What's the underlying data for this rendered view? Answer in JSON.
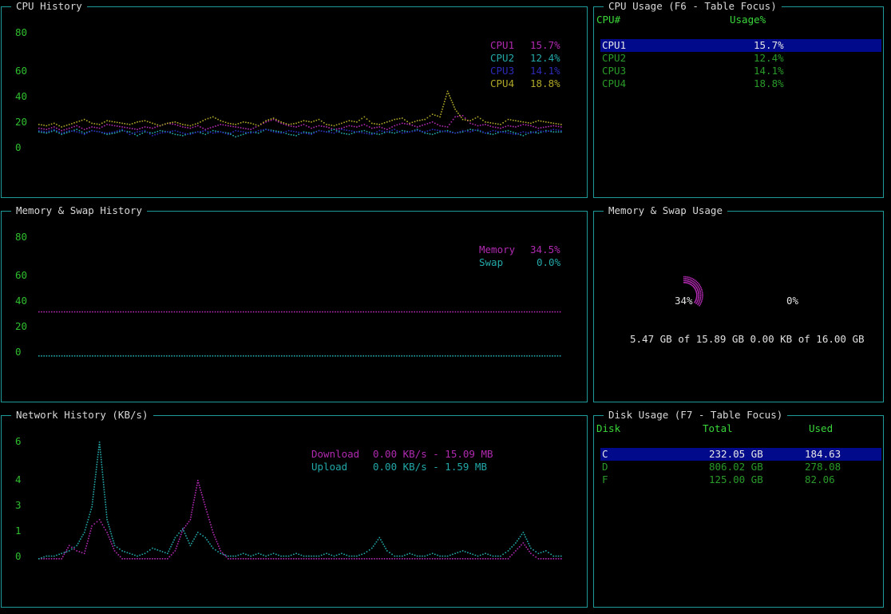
{
  "colors": {
    "border": "#1f9a9a",
    "cpu1": "#b02ab0",
    "cpu2": "#23a8a8",
    "cpu3": "#2b2bb8",
    "cpu4": "#b0a828",
    "memory": "#b02ab0",
    "swap": "#23a8a8",
    "download": "#b02ab0",
    "upload": "#23a8a8",
    "selection": "#000a8a",
    "axis": "#2fbf2f"
  },
  "cpu_history": {
    "title": "CPU History",
    "y_ticks": [
      "80",
      "60",
      "40",
      "20",
      "0"
    ],
    "legend": [
      {
        "name": "CPU1",
        "value": "15.7%"
      },
      {
        "name": "CPU2",
        "value": "12.4%"
      },
      {
        "name": "CPU3",
        "value": "14.1%"
      },
      {
        "name": "CPU4",
        "value": "18.8%"
      }
    ]
  },
  "cpu_usage": {
    "title": "CPU Usage (F6 - Table Focus)",
    "col_cpu": "CPU#",
    "col_usage": "Usage%",
    "rows": [
      {
        "cpu": "CPU1",
        "usage": "15.7%"
      },
      {
        "cpu": "CPU2",
        "usage": "12.4%"
      },
      {
        "cpu": "CPU3",
        "usage": "14.1%"
      },
      {
        "cpu": "CPU4",
        "usage": "18.8%"
      }
    ]
  },
  "mem_history": {
    "title": "Memory & Swap History",
    "y_ticks": [
      "80",
      "60",
      "40",
      "20",
      "0"
    ],
    "legend": [
      {
        "name": "Memory",
        "value": "34.5%"
      },
      {
        "name": "Swap",
        "value": "0.0%"
      }
    ]
  },
  "mem_usage": {
    "title": "Memory & Swap Usage",
    "mem_pct": "34%",
    "swap_pct": "0%",
    "summary": "5.47 GB of 15.89 GB 0.00 KB of 16.00 GB"
  },
  "net_history": {
    "title": "Network History (KB/s)",
    "y_ticks": [
      "6",
      "4",
      "3",
      "1",
      "0"
    ],
    "download_label": "Download",
    "download_value": "0.00 KB/s - 15.09 MB",
    "upload_label": "Upload",
    "upload_value": "0.00 KB/s - 1.59 MB"
  },
  "disk_usage": {
    "title": "Disk Usage (F7 - Table Focus)",
    "col_disk": "Disk",
    "col_total": "Total",
    "col_used": "Used",
    "rows": [
      {
        "disk": "C",
        "total": "232.05 GB",
        "used": "184.63"
      },
      {
        "disk": "D",
        "total": "806.02 GB",
        "used": "278.08"
      },
      {
        "disk": "F",
        "total": "125.00 GB",
        "used": "82.06"
      }
    ]
  },
  "chart_data": [
    {
      "type": "line",
      "ylim": [
        0,
        80
      ],
      "series": [
        {
          "name": "CPU1",
          "values": [
            15,
            14,
            16,
            13,
            15,
            17,
            14,
            16,
            15,
            18,
            17,
            16,
            15,
            14,
            16,
            15,
            17,
            19,
            18,
            16,
            15,
            17,
            14,
            16,
            18,
            17,
            16,
            15,
            14,
            17,
            20,
            22,
            19,
            17,
            16,
            18,
            15,
            17,
            16,
            14,
            15,
            17,
            16,
            18,
            15,
            16,
            14,
            17,
            19,
            18,
            16,
            18,
            20,
            17,
            16,
            24,
            25,
            19,
            17,
            18,
            16,
            15,
            17,
            16,
            18,
            17,
            15,
            16,
            17,
            16
          ]
        },
        {
          "name": "CPU2",
          "values": [
            12,
            11,
            13,
            10,
            12,
            14,
            11,
            13,
            12,
            10,
            11,
            13,
            12,
            9,
            12,
            11,
            13,
            12,
            10,
            9,
            11,
            12,
            10,
            13,
            12,
            11,
            8,
            10,
            12,
            11,
            14,
            13,
            12,
            10,
            9,
            12,
            11,
            13,
            12,
            14,
            11,
            10,
            12,
            13,
            11,
            10,
            12,
            11,
            13,
            12,
            14,
            11,
            10,
            12,
            13,
            11,
            12,
            14,
            13,
            11,
            10,
            12,
            13,
            11,
            9,
            12,
            11,
            13,
            12,
            12
          ]
        },
        {
          "name": "CPU3",
          "values": [
            13,
            12,
            14,
            11,
            13,
            12,
            10,
            13,
            12,
            11,
            12,
            14,
            10,
            12,
            13,
            9,
            11,
            12,
            13,
            11,
            10,
            12,
            13,
            11,
            12,
            10,
            13,
            12,
            11,
            13,
            14,
            12,
            11,
            13,
            12,
            11,
            10,
            13,
            12,
            11,
            14,
            13,
            12,
            11,
            10,
            13,
            12,
            14,
            11,
            12,
            13,
            12,
            14,
            13,
            12,
            11,
            13,
            12,
            14,
            11,
            13,
            12,
            11,
            10,
            12,
            11,
            13,
            12,
            14,
            13
          ]
        },
        {
          "name": "CPU4",
          "values": [
            18,
            17,
            19,
            16,
            18,
            20,
            22,
            19,
            18,
            21,
            20,
            19,
            18,
            20,
            21,
            19,
            17,
            19,
            20,
            18,
            17,
            19,
            22,
            24,
            21,
            19,
            18,
            20,
            19,
            17,
            21,
            23,
            20,
            18,
            19,
            21,
            20,
            22,
            18,
            17,
            19,
            21,
            20,
            24,
            19,
            18,
            20,
            22,
            23,
            19,
            21,
            22,
            26,
            24,
            44,
            30,
            22,
            21,
            24,
            20,
            19,
            18,
            22,
            21,
            20,
            19,
            21,
            20,
            19,
            18
          ]
        }
      ]
    },
    {
      "type": "line",
      "ylim": [
        0,
        80
      ],
      "series": [
        {
          "name": "Memory",
          "values": [
            34.5,
            34.5
          ]
        },
        {
          "name": "Swap",
          "values": [
            0.0,
            0.0
          ]
        }
      ]
    },
    {
      "type": "line",
      "ylim": [
        0,
        6
      ],
      "series": [
        {
          "name": "Download",
          "values": [
            0,
            0,
            0,
            0,
            0.5,
            0.3,
            0.2,
            1.5,
            2,
            1,
            0.3,
            0,
            0,
            0,
            0,
            0,
            0,
            0,
            0.3,
            1.2,
            2,
            4,
            3,
            1,
            0.3,
            0,
            0,
            0,
            0,
            0,
            0,
            0,
            0,
            0,
            0,
            0,
            0,
            0,
            0,
            0,
            0,
            0,
            0,
            0,
            0,
            0,
            0,
            0,
            0,
            0,
            0,
            0,
            0,
            0,
            0,
            0,
            0,
            0,
            0,
            0,
            0,
            0,
            0,
            0.3,
            0.6,
            0.2,
            0,
            0,
            0,
            0
          ]
        },
        {
          "name": "Upload",
          "values": [
            0,
            0.1,
            0.1,
            0.2,
            0.3,
            0.5,
            1,
            3,
            6,
            2,
            0.5,
            0.3,
            0.2,
            0.1,
            0.2,
            0.4,
            0.3,
            0.2,
            0.8,
            1.3,
            0.5,
            1,
            0.8,
            0.4,
            0.2,
            0.1,
            0.1,
            0.2,
            0.1,
            0.2,
            0.1,
            0.2,
            0.1,
            0.1,
            0.2,
            0.1,
            0.1,
            0.1,
            0.2,
            0.1,
            0.2,
            0.1,
            0.1,
            0.2,
            0.4,
            0.8,
            0.3,
            0.1,
            0.1,
            0.2,
            0.1,
            0.1,
            0.2,
            0.1,
            0.1,
            0.2,
            0.3,
            0.2,
            0.1,
            0.2,
            0.1,
            0.1,
            0.3,
            0.6,
            1,
            0.4,
            0.2,
            0.3,
            0.1,
            0.1
          ]
        }
      ]
    }
  ]
}
